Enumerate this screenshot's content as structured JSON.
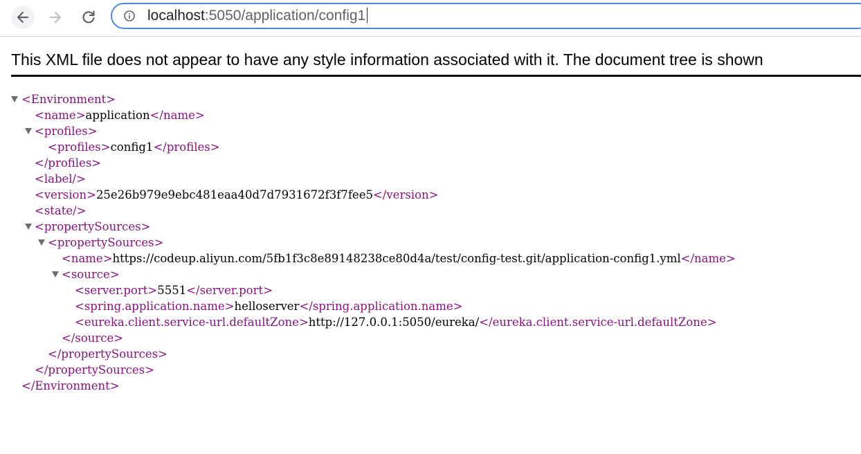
{
  "browser": {
    "url_host": "localhost",
    "url_rest": ":5050/application/config1"
  },
  "viewer": {
    "notice": "This XML file does not appear to have any style information associated with it. The document tree is shown"
  },
  "xml": {
    "env_open": "<Environment>",
    "name_open": "<name>",
    "name_val": "application",
    "name_close": "</name>",
    "profiles_open": "<profiles>",
    "profile_open": "<profiles>",
    "profile_val": "config1",
    "profile_close": "</profiles>",
    "profiles_close": "</profiles>",
    "label": "<label/>",
    "version_open": "<version>",
    "version_val": "25e26b979e9ebc481eaa40d7d7931672f3f7fee5",
    "version_close": "</version>",
    "state": "<state/>",
    "ps_outer_open": "<propertySources>",
    "ps_inner_open": "<propertySources>",
    "src_name_open": "<name>",
    "src_name_val": "https://codeup.aliyun.com/5fb1f3c8e89148238ce80d4a/test/config-test.git/application-config1.yml",
    "src_name_close": "</name>",
    "source_open": "<source>",
    "port_open": "<server.port>",
    "port_val": "5551",
    "port_close": "</server.port>",
    "appname_open": "<spring.application.name>",
    "appname_val": "helloserver",
    "appname_close": "</spring.application.name>",
    "eureka_open": "<eureka.client.service-url.defaultZone>",
    "eureka_val": "http://127.0.0.1:5050/eureka/",
    "eureka_close": "</eureka.client.service-url.defaultZone>",
    "source_close": "</source>",
    "ps_inner_close": "</propertySources>",
    "ps_outer_close": "</propertySources>",
    "env_close": "</Environment>"
  },
  "icons": {
    "back": "arrow-left-icon",
    "forward": "arrow-right-icon",
    "reload": "reload-icon",
    "info": "info-circle-icon",
    "collapse": "triangle-down-icon"
  }
}
